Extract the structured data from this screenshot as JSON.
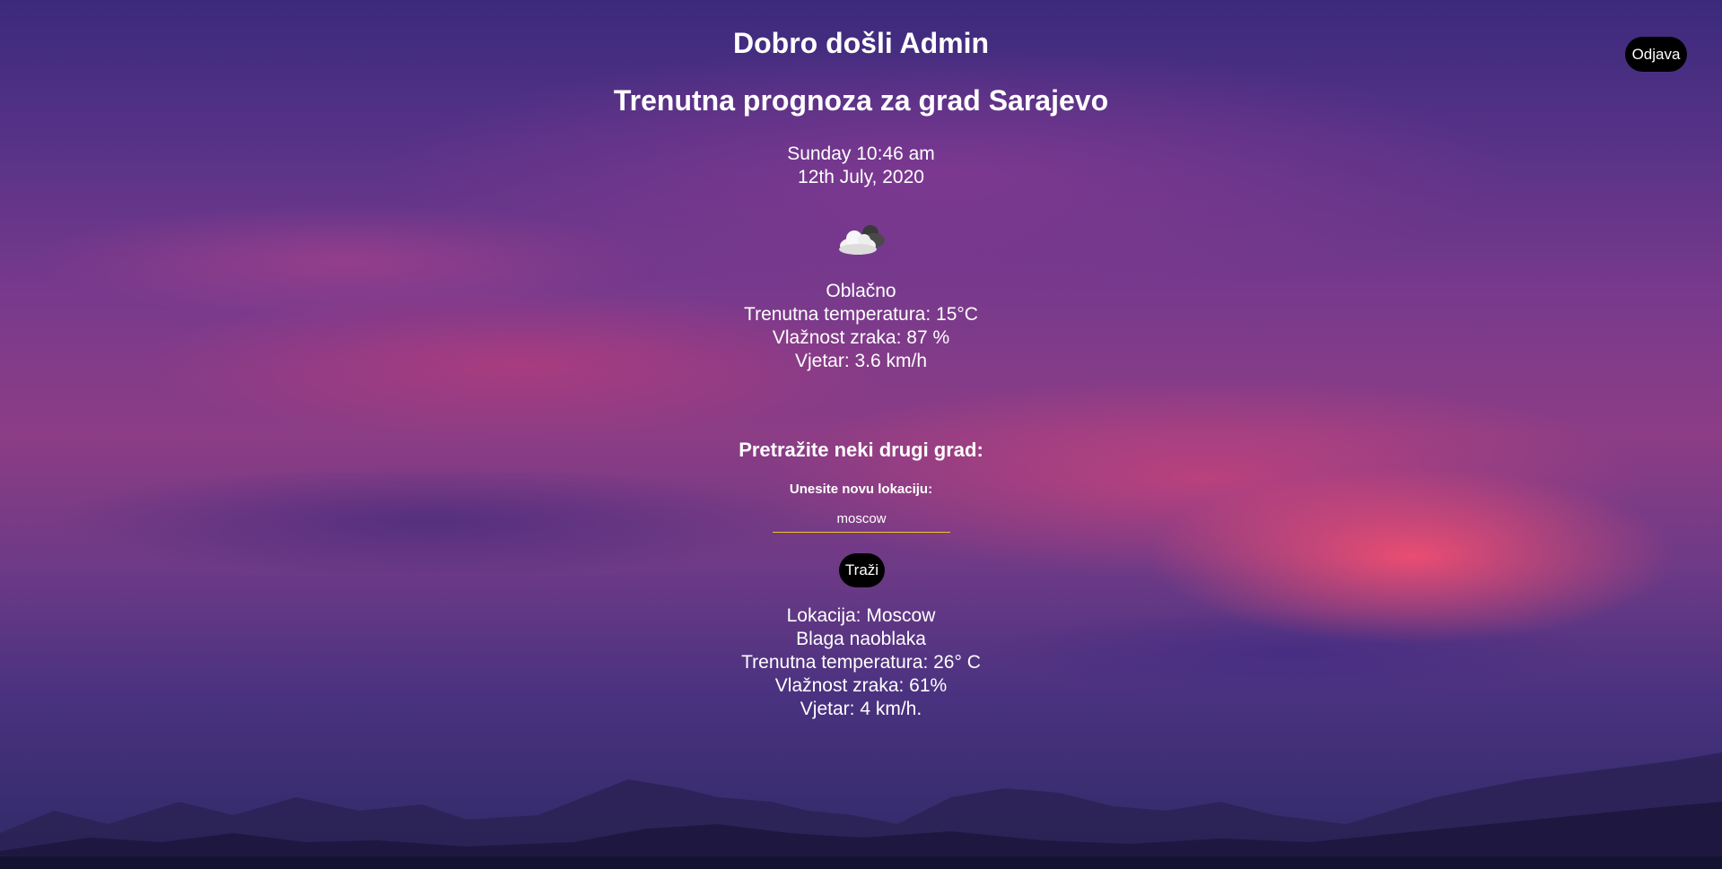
{
  "header": {
    "welcome": "Dobro došli Admin",
    "logout_label": "Odjava"
  },
  "current": {
    "title": "Trenutna prognoza za grad Sarajevo",
    "day_time": "Sunday 10:46 am",
    "date": "12th July, 2020",
    "icon": "cloud-sun-icon",
    "condition": "Oblačno",
    "temperature": "Trenutna temperatura: 15°C",
    "humidity": "Vlažnost zraka: 87 %",
    "wind": "Vjetar: 3.6 km/h"
  },
  "search": {
    "title": "Pretražite neki drugi grad:",
    "label": "Unesite novu lokaciju:",
    "value": "moscow",
    "button_label": "Traži"
  },
  "result": {
    "location": "Lokacija: Moscow",
    "condition": "Blaga naoblaka",
    "temperature": "Trenutna temperatura: 26° C",
    "humidity": "Vlažnost zraka: 61%",
    "wind": "Vjetar: 4 km/h."
  },
  "colors": {
    "input_underline": "#f1c232",
    "button_bg": "#000000",
    "text": "#ffffff"
  }
}
